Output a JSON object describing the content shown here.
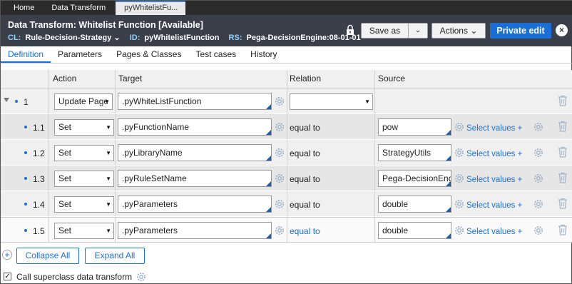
{
  "tabs": [
    "Home",
    "Data Transform",
    "pyWhitelistFu..."
  ],
  "header": {
    "title": "Data Transform: Whitelist Function",
    "status": "[Available]",
    "cl_key": "CL:",
    "cl_value": "Rule-Decision-Strategy",
    "id_key": "ID:",
    "id_value": "pyWhitelistFunction",
    "rs_key": "RS:",
    "rs_value": "Pega-DecisionEngine:08-01-01",
    "save_label": "Save as",
    "actions_label": "Actions",
    "private_edit_label": "Private edit"
  },
  "subtabs": [
    "Definition",
    "Parameters",
    "Pages & Classes",
    "Test cases",
    "History"
  ],
  "grid": {
    "headers": {
      "action": "Action",
      "target": "Target",
      "relation": "Relation",
      "source": "Source"
    },
    "rows": [
      {
        "num": "1",
        "action": "Update Page",
        "target": ".pyWhiteListFunction",
        "relation": "",
        "source": "",
        "select_values": ""
      },
      {
        "num": "1.1",
        "action": "Set",
        "target": ".pyFunctionName",
        "relation": "equal to",
        "source": "pow",
        "select_values": "Select values +"
      },
      {
        "num": "1.2",
        "action": "Set",
        "target": ".pyLibraryName",
        "relation": "equal to",
        "source": "StrategyUtils",
        "select_values": "Select values +"
      },
      {
        "num": "1.3",
        "action": "Set",
        "target": ".pyRuleSetName",
        "relation": "equal to",
        "source": "Pega-DecisionEngin",
        "select_values": "Select values +"
      },
      {
        "num": "1.4",
        "action": "Set",
        "target": ".pyParameters",
        "relation": "equal to",
        "source": "double",
        "select_values": "Select values +"
      },
      {
        "num": "1.5",
        "action": "Set",
        "target": ".pyParameters",
        "relation": "equal to",
        "source": "double",
        "select_values": "Select values +"
      }
    ]
  },
  "footer": {
    "collapse_all": "Collapse All",
    "expand_all": "Expand All",
    "superclass_label": "Call superclass data transform"
  },
  "colors": {
    "accent": "#1a6fd6",
    "header_bg": "#3b3f4a",
    "tabbar_bg": "#2b2b2b"
  }
}
